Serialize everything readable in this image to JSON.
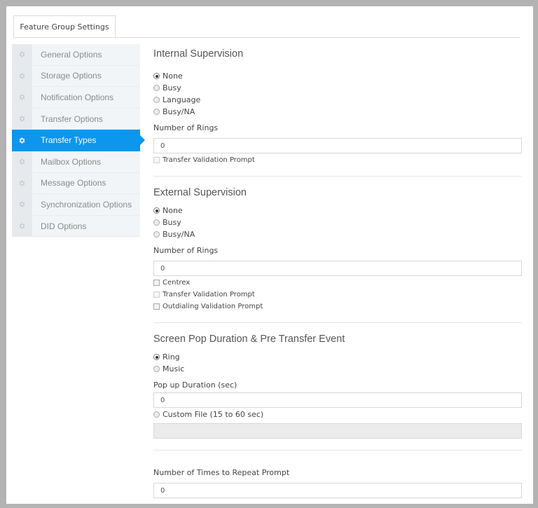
{
  "tab": {
    "label": "Feature Group Settings"
  },
  "sidebar": {
    "items": [
      {
        "label": "General Options",
        "active": false
      },
      {
        "label": "Storage Options",
        "active": false
      },
      {
        "label": "Notification Options",
        "active": false
      },
      {
        "label": "Transfer Options",
        "active": false
      },
      {
        "label": "Transfer Types",
        "active": true
      },
      {
        "label": "Mailbox Options",
        "active": false
      },
      {
        "label": "Message Options",
        "active": false
      },
      {
        "label": "Synchronization Options",
        "active": false
      },
      {
        "label": "DID Options",
        "active": false
      }
    ],
    "icon": "gear-icon",
    "active_color": "#0d96ed"
  },
  "internal": {
    "title": "Internal Supervision",
    "options": [
      "None",
      "Busy",
      "Language",
      "Busy/NA"
    ],
    "selected": "None",
    "rings_label": "Number of Rings",
    "rings_value": "0",
    "validation_label": "Transfer Validation Prompt"
  },
  "external": {
    "title": "External Supervision",
    "options": [
      "None",
      "Busy",
      "Busy/NA"
    ],
    "selected": "None",
    "rings_label": "Number of Rings",
    "rings_value": "0",
    "centrex_label": "Centrex",
    "validation_label": "Transfer Validation Prompt",
    "outdialing_label": "Outdialing Validation Prompt"
  },
  "screenpop": {
    "title": "Screen Pop Duration & Pre Transfer Event",
    "options": [
      "Ring",
      "Music"
    ],
    "selected": "Ring",
    "duration_label": "Pop up Duration (sec)",
    "duration_value": "0",
    "custom_file_label": "Custom File (15 to 60 sec)",
    "custom_file_value": ""
  },
  "repeat": {
    "label": "Number of Times to Repeat Prompt",
    "value": "0"
  }
}
